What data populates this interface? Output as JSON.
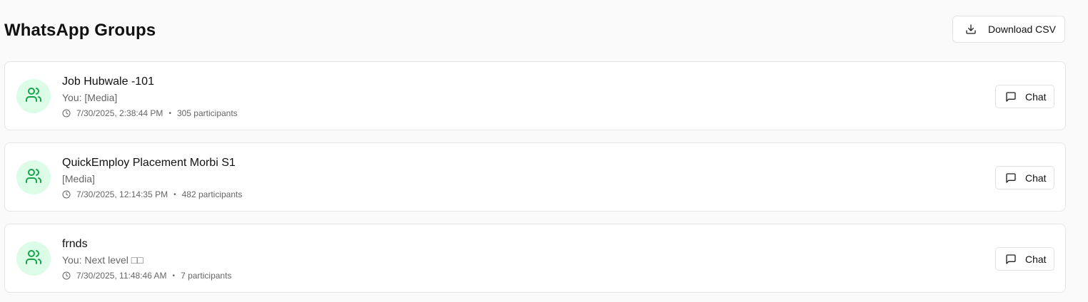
{
  "header": {
    "title": "WhatsApp Groups",
    "download_label": "Download CSV"
  },
  "groups": [
    {
      "name": "Job Hubwale -101",
      "last_message": "You: [Media]",
      "timestamp": "7/30/2025, 2:38:44 PM",
      "participants": "305 participants",
      "chat_label": "Chat"
    },
    {
      "name": "QuickEmploy Placement Morbi S1",
      "last_message": "[Media]",
      "timestamp": "7/30/2025, 12:14:35 PM",
      "participants": "482 participants",
      "chat_label": "Chat"
    },
    {
      "name": "frnds",
      "last_message": "You: Next level □□",
      "timestamp": "7/30/2025, 11:48:46 AM",
      "participants": "7 participants",
      "chat_label": "Chat"
    }
  ],
  "meta_separator": "•",
  "colors": {
    "accent_green": "#16a34a",
    "avatar_bg": "#dcfce7",
    "page_bg": "#fafafa"
  },
  "icons": {
    "download": "download-icon",
    "group": "users-icon",
    "clock": "clock-icon",
    "chat": "message-square-icon"
  }
}
